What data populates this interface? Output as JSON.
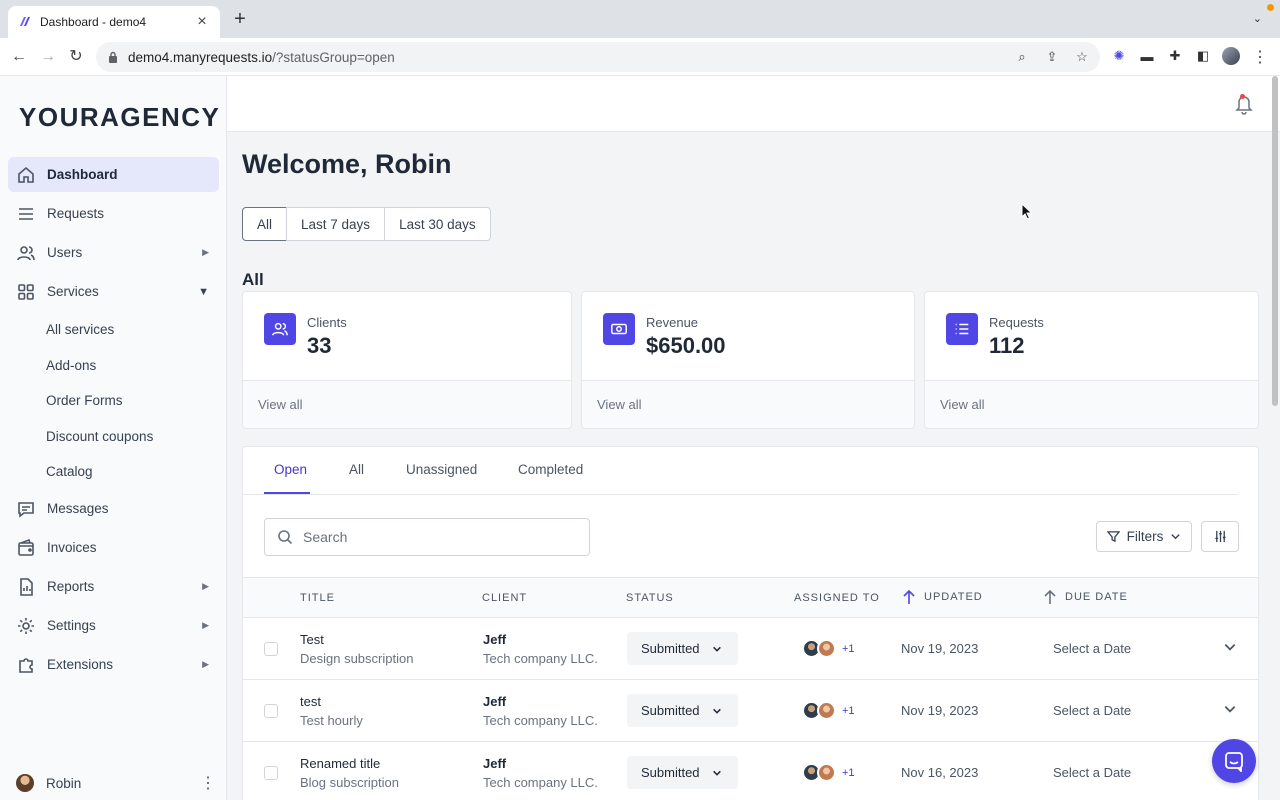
{
  "browser": {
    "tab_title": "Dashboard - demo4",
    "url_host": "demo4.manyrequests.io",
    "url_path": "/?statusGroup=open"
  },
  "sidebar": {
    "logo": "YOURAGENCY",
    "items": [
      {
        "label": "Dashboard",
        "icon": "home-icon",
        "active": true
      },
      {
        "label": "Requests",
        "icon": "list-icon"
      },
      {
        "label": "Users",
        "icon": "users-icon",
        "caret": "▶"
      },
      {
        "label": "Services",
        "icon": "grid-icon",
        "caret": "▼"
      },
      {
        "label": "Messages",
        "icon": "chat-icon"
      },
      {
        "label": "Invoices",
        "icon": "wallet-icon"
      },
      {
        "label": "Reports",
        "icon": "report-icon",
        "caret": "▶"
      },
      {
        "label": "Settings",
        "icon": "gear-icon",
        "caret": "▶"
      },
      {
        "label": "Extensions",
        "icon": "puzzle-icon",
        "caret": "▶"
      }
    ],
    "services_sub": [
      "All services",
      "Add-ons",
      "Order Forms",
      "Discount coupons",
      "Catalog"
    ],
    "user_name": "Robin"
  },
  "main": {
    "welcome": "Welcome, Robin",
    "ranges": [
      "All",
      "Last 7 days",
      "Last 30 days"
    ],
    "section_title": "All",
    "cards": [
      {
        "label": "Clients",
        "value": "33",
        "link": "View all",
        "icon": "users-icon"
      },
      {
        "label": "Revenue",
        "value": "$650.00",
        "link": "View all",
        "icon": "cash-icon"
      },
      {
        "label": "Requests",
        "value": "112",
        "link": "View all",
        "icon": "list-icon"
      }
    ],
    "tabs": [
      "Open",
      "All",
      "Unassigned",
      "Completed"
    ],
    "search_placeholder": "Search",
    "filters_label": "Filters",
    "columns": [
      "TITLE",
      "CLIENT",
      "STATUS",
      "ASSIGNED TO",
      "UPDATED",
      "DUE DATE"
    ],
    "rows": [
      {
        "title": "Test",
        "subtitle": "Design subscription",
        "client": "Jeff",
        "company": "Tech company LLC.",
        "status": "Submitted",
        "extra": "+1",
        "updated": "Nov 19, 2023",
        "due": "Select a Date"
      },
      {
        "title": "test",
        "subtitle": "Test hourly",
        "client": "Jeff",
        "company": "Tech company LLC.",
        "status": "Submitted",
        "extra": "+1",
        "updated": "Nov 19, 2023",
        "due": "Select a Date"
      },
      {
        "title": "Renamed title",
        "subtitle": "Blog subscription",
        "client": "Jeff",
        "company": "Tech company LLC.",
        "status": "Submitted",
        "extra": "+1",
        "updated": "Nov 16, 2023",
        "due": "Select a Date"
      }
    ]
  },
  "colors": {
    "accent": "#4f46e5",
    "active_nav_bg": "#e5e7fb"
  }
}
